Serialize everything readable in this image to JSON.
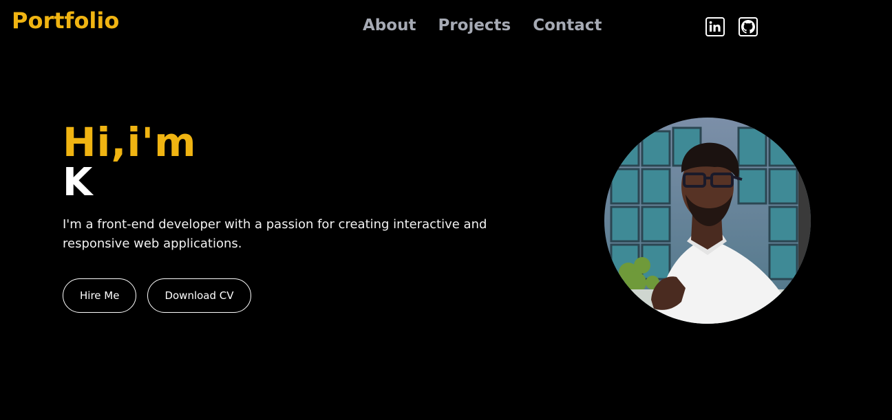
{
  "header": {
    "logo": "Portfolio",
    "nav": [
      {
        "label": "About"
      },
      {
        "label": "Projects"
      },
      {
        "label": "Contact"
      }
    ],
    "social": [
      {
        "icon": "linkedin-icon"
      },
      {
        "icon": "github-icon"
      }
    ]
  },
  "hero": {
    "greeting": "Hi,i'm",
    "name": "K",
    "tagline": "I'm a front-end developer with a passion for creating interactive and responsive web applications.",
    "buttons": {
      "hire": "Hire Me",
      "download": "Download CV"
    }
  },
  "colors": {
    "accent": "#f0b412",
    "background": "#000000",
    "nav_text": "#a6aab4",
    "text": "#ffffff"
  }
}
